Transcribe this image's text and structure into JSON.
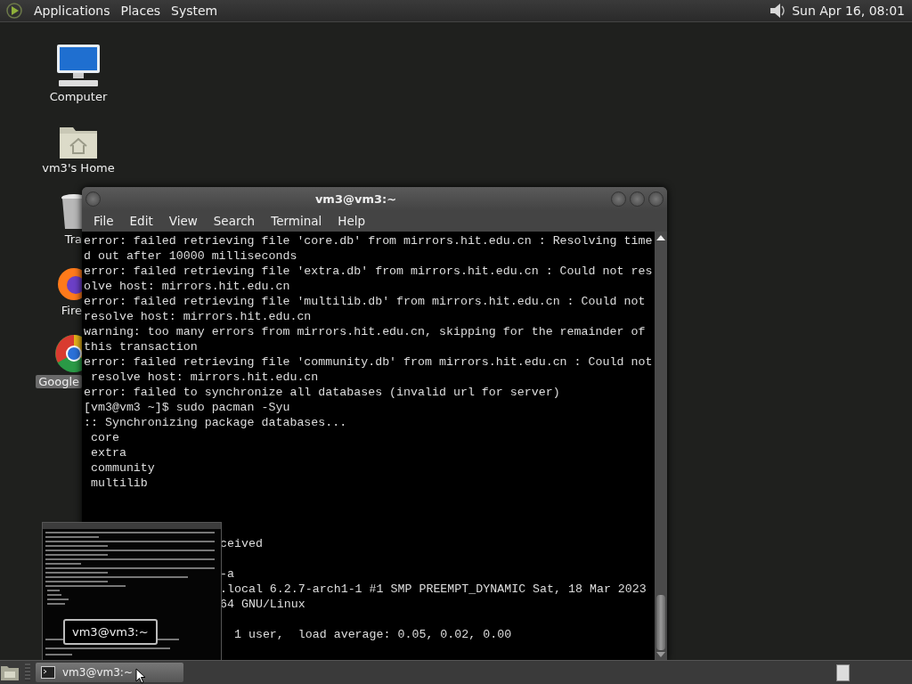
{
  "top_panel": {
    "menus": [
      "Applications",
      "Places",
      "System"
    ],
    "clock": "Sun Apr 16, 08:01"
  },
  "desktop_icons": [
    {
      "kind": "computer",
      "label": "Computer",
      "clipped": false
    },
    {
      "kind": "home",
      "label": "vm3's Home",
      "clipped": false
    },
    {
      "kind": "trash",
      "label": "Tra",
      "clipped": true
    },
    {
      "kind": "firefox",
      "label": "Fire",
      "clipped": true
    },
    {
      "kind": "chrome",
      "label": "Google",
      "clipped": true
    }
  ],
  "terminal_window": {
    "title": "vm3@vm3:~",
    "menu": [
      "File",
      "Edit",
      "View",
      "Search",
      "Terminal",
      "Help"
    ],
    "lines": [
      {
        "text": "error: failed retrieving file 'core.db' from mirrors.hit.edu.cn : Resolving time",
        "clipped": false
      },
      {
        "text": "d out after 10000 milliseconds",
        "clipped": false
      },
      {
        "text": "error: failed retrieving file 'extra.db' from mirrors.hit.edu.cn : Could not res",
        "clipped": false
      },
      {
        "text": "olve host: mirrors.hit.edu.cn",
        "clipped": false
      },
      {
        "text": "error: failed retrieving file 'multilib.db' from mirrors.hit.edu.cn : Could not",
        "clipped": false
      },
      {
        "text": "resolve host: mirrors.hit.edu.cn",
        "clipped": false
      },
      {
        "text": "warning: too many errors from mirrors.hit.edu.cn, skipping for the remainder of",
        "clipped": false
      },
      {
        "text": "this transaction",
        "clipped": false
      },
      {
        "text": "error: failed retrieving file 'community.db' from mirrors.hit.edu.cn : Could not",
        "clipped": false
      },
      {
        "text": " resolve host: mirrors.hit.edu.cn",
        "clipped": false
      },
      {
        "text": "error: failed to synchronize all databases (invalid url for server)",
        "clipped": false
      },
      {
        "text": "[vm3@vm3 ~]$ sudo pacman -Syu",
        "clipped": false
      },
      {
        "text": ":: Synchronizing package databases...",
        "clipped": false
      },
      {
        "text": " core",
        "clipped": false
      },
      {
        "text": " extra",
        "clipped": false
      },
      {
        "text": " community",
        "clipped": false
      },
      {
        "text": " multilib",
        "clipped": false
      },
      {
        "kind": "blank"
      },
      {
        "kind": "blank"
      },
      {
        "kind": "blank"
      },
      {
        "text": "ceived",
        "clipped": true
      },
      {
        "kind": "blank"
      },
      {
        "text": "-a",
        "clipped": true
      },
      {
        "text": ".local 6.2.7-arch1-1 #1 SMP PREEMPT_DYNAMIC Sat, 18 Mar 2023",
        "clipped": true
      },
      {
        "text": "64 GNU/Linux",
        "clipped": true
      },
      {
        "kind": "blank"
      },
      {
        "text": "  1 user,  load average: 0.05, 0.02, 0.00",
        "clipped": true
      }
    ]
  },
  "window_preview": {
    "tooltip": "vm3@vm3:~"
  },
  "bottom_panel": {
    "tasks": [
      {
        "label": "vm3@vm3:~",
        "selected": true
      }
    ]
  }
}
